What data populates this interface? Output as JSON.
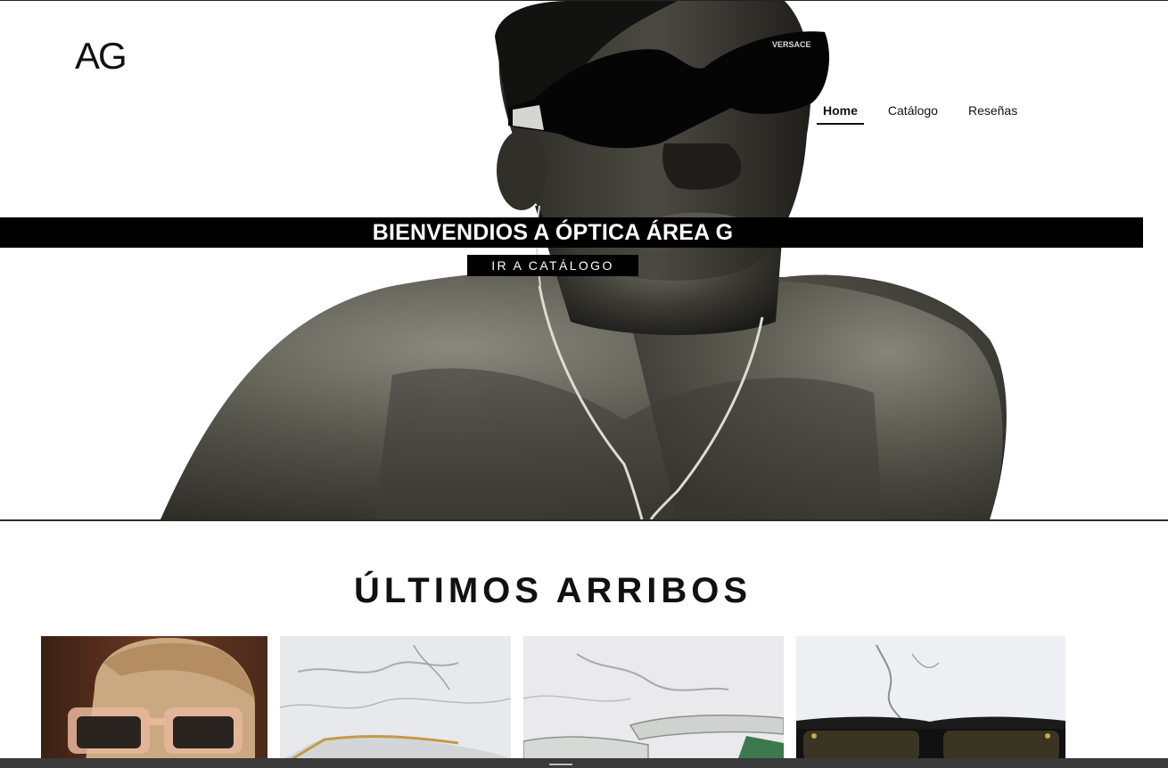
{
  "header": {
    "logo_text": "AG",
    "nav": [
      {
        "label": "Home",
        "active": true
      },
      {
        "label": "Catálogo",
        "active": false
      },
      {
        "label": "Reseñas",
        "active": false
      }
    ]
  },
  "hero": {
    "title": "BIENVENDIOS A ÓPTICA ÁREA G",
    "cta_label": "IR A CATÁLOGO",
    "sunglasses_brand": "VERSACE"
  },
  "arrivals": {
    "title": "ÚLTIMOS ARRIBOS",
    "products": [
      {
        "image": "model-tortoise-clear-sunglasses-photo"
      },
      {
        "image": "gold-metal-frame-on-marble-photo"
      },
      {
        "image": "clear-acetate-frame-on-marble-photo"
      },
      {
        "image": "black-frame-on-marble-photo"
      }
    ]
  },
  "colors": {
    "background": "#ffffff",
    "band": "#000000",
    "text": "#111111",
    "bottom_bar": "#3a3a3a"
  }
}
